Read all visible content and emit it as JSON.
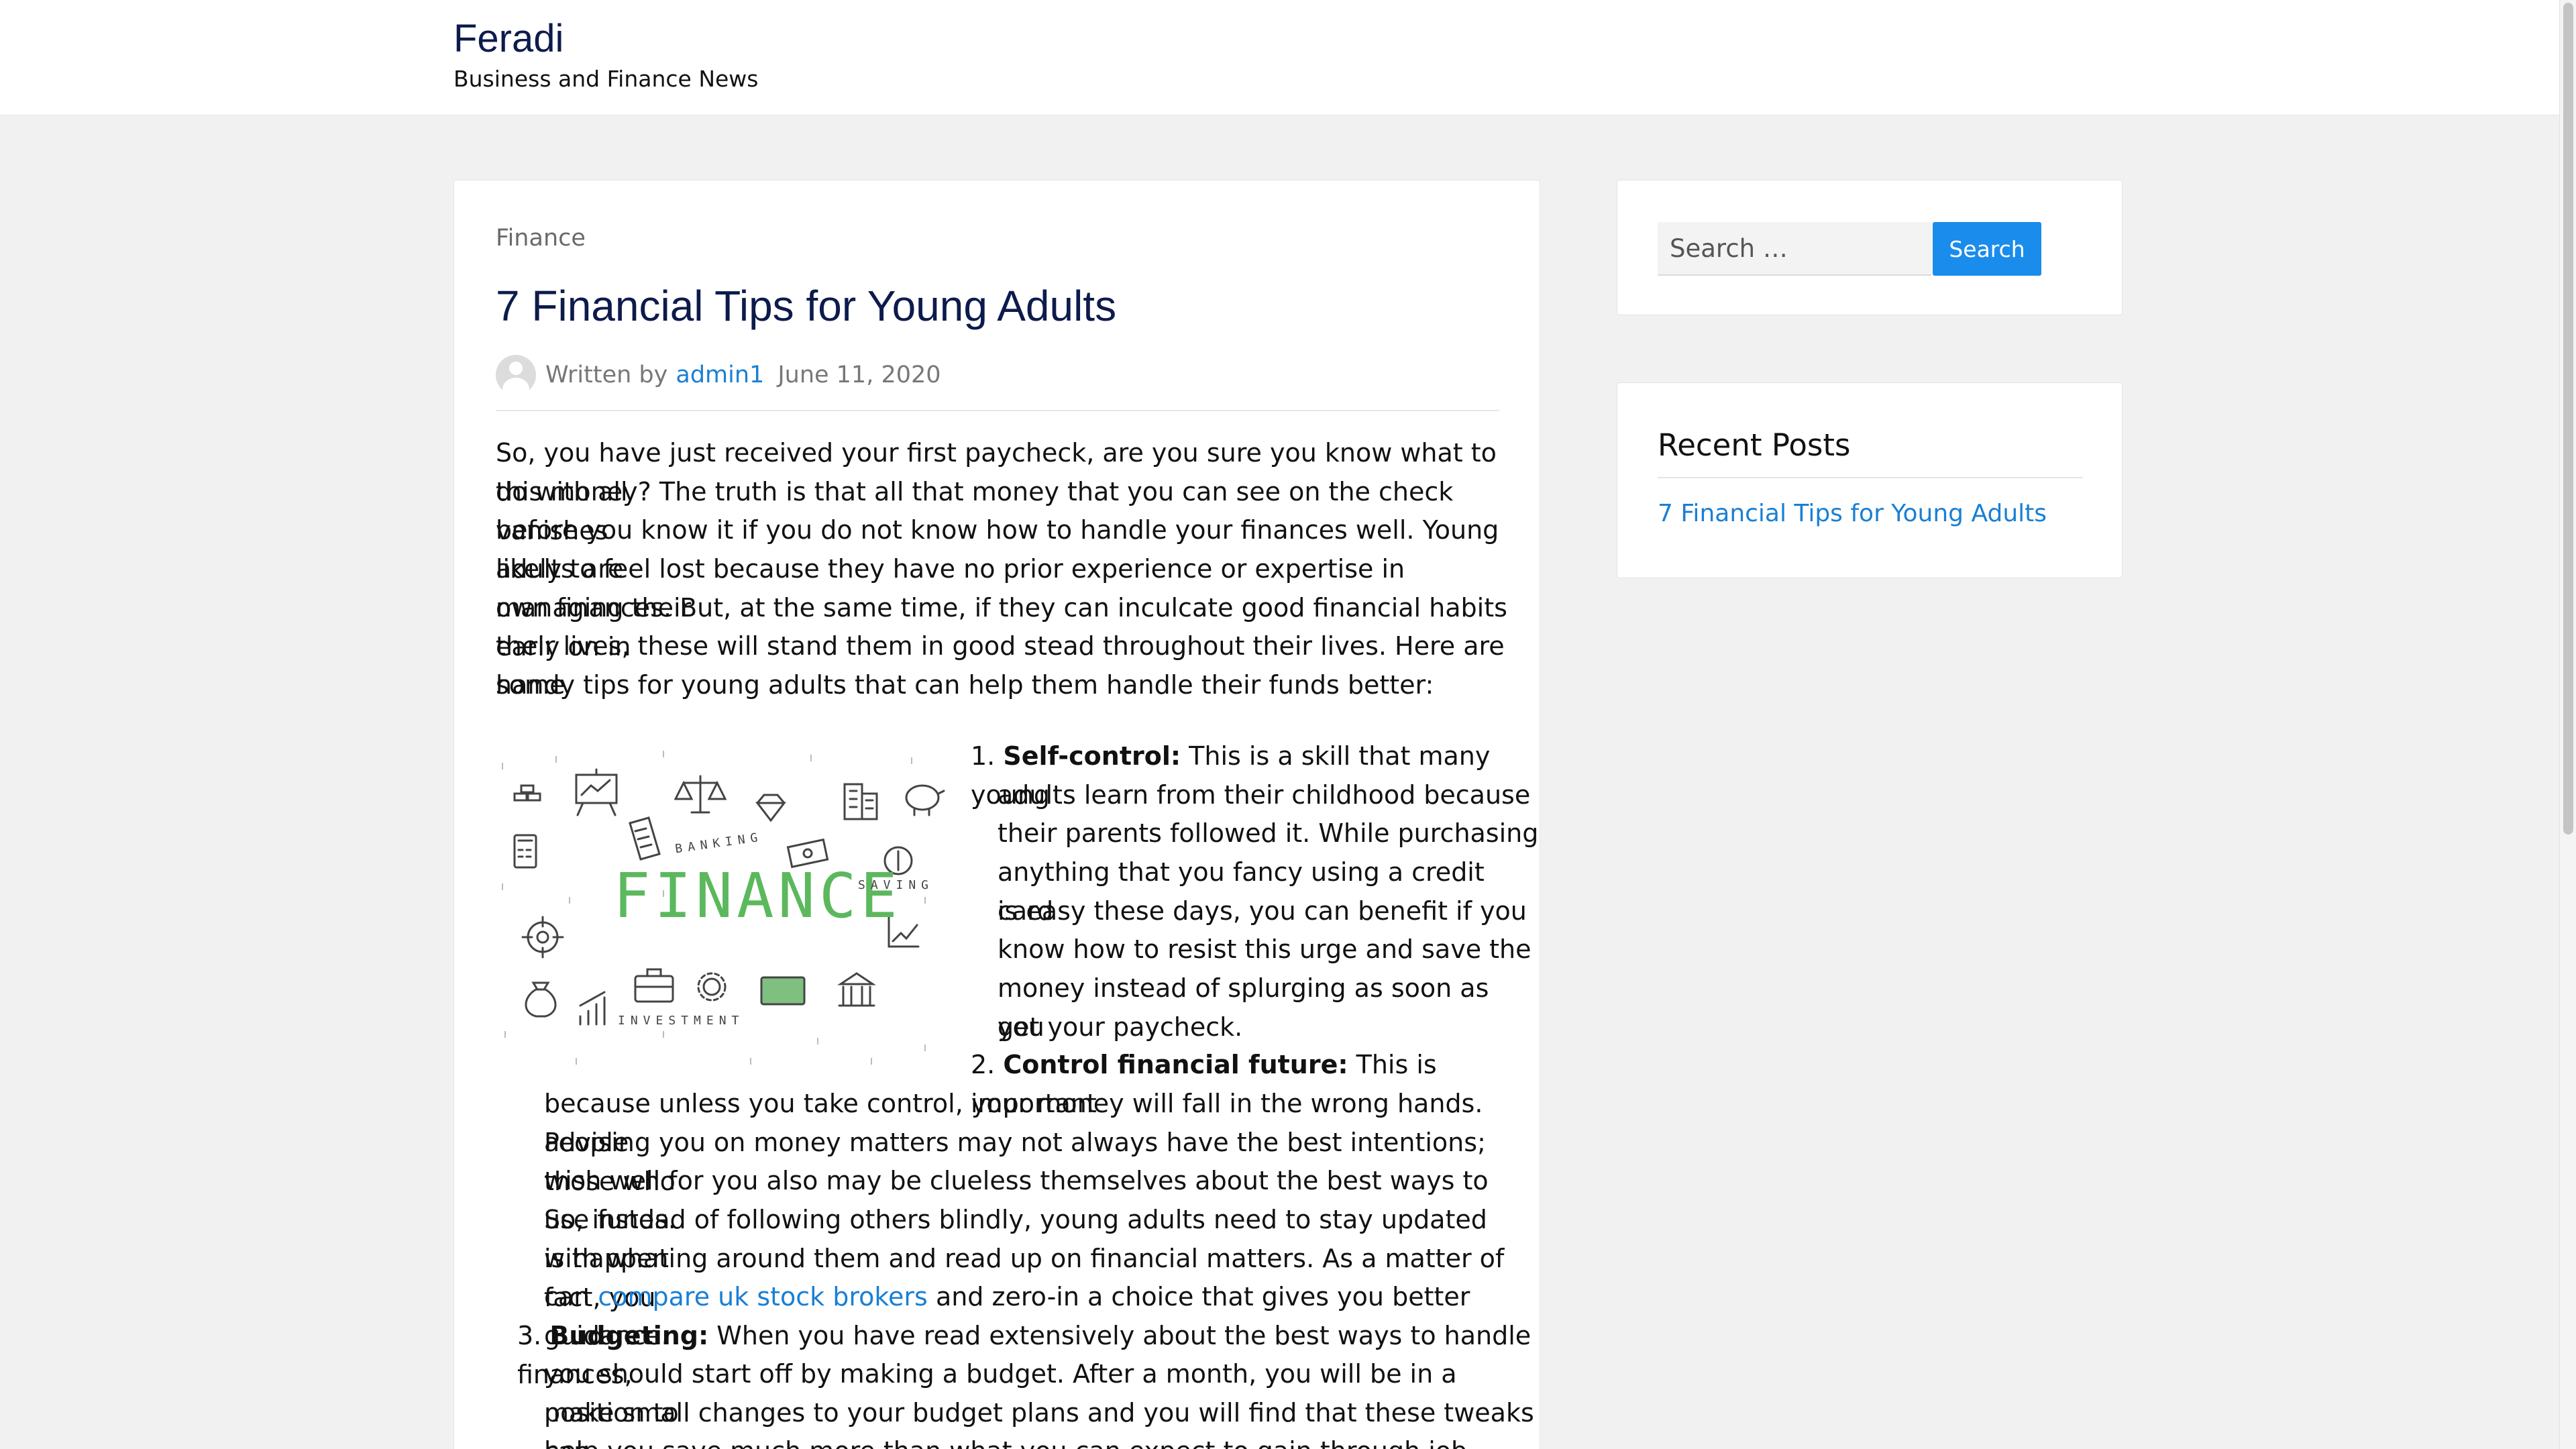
{
  "header": {
    "site_title": "Feradi",
    "site_description": "Business and Finance News"
  },
  "article": {
    "category": "Finance",
    "title": "7 Financial Tips for Young Adults",
    "meta": {
      "written_by": "Written by",
      "author": "admin1",
      "date": "June 11, 2020"
    },
    "intro_lines": [
      "So, you have just received your first paycheck, are you sure you know what to do with all",
      "this money? The truth is that all that money that you can see on the check vanishes",
      "before you know it if you do not know how to handle your finances well. Young adults are",
      "likely to feel lost because they have no prior experience or expertise in managing their",
      "own finances. But, at the same time, if they can inculcate good financial habits early on in",
      "their lives, these will stand them in good stead throughout their lives. Here are some",
      "handy tips for young adults that can help them handle their funds better:"
    ],
    "image_labels": {
      "main": "FINANCE",
      "banking": "BANKING",
      "saving": "SAVING",
      "investment": "INVESTMENT"
    },
    "tip1": {
      "number": "1.",
      "heading": "Self-control:",
      "first_line": " This is a skill that many young",
      "lines": [
        "adults learn from their childhood because",
        "their parents followed it. While purchasing",
        "anything that you fancy using a credit card",
        "is easy these days, you can benefit if you",
        "know how to resist this urge and save the",
        "money instead of splurging as soon as you",
        "get your paycheck."
      ]
    },
    "tip2": {
      "number": "2.",
      "heading": "Control financial future:",
      "first_line": " This is important",
      "lines": [
        "because unless you take control, your money will fall in the wrong hands. People",
        "advising you on money matters may not always have the best intentions; those who",
        "wish well for you also may be clueless themselves about the best ways to use funds.",
        "So, instead of following others blindly, young adults need to stay updated with what",
        "is happening around them and read up on financial matters. As a matter of fact, you"
      ],
      "last_line_prefix": "can ",
      "link_text": "compare uk stock brokers",
      "last_line_suffix": " and zero-in a choice that gives you better guidance."
    },
    "tip3": {
      "number": "3.",
      "heading": "Budgeting:",
      "first_line": " When you have read extensively about the best ways to handle finances,",
      "lines": [
        "you should start off by making a budget. After a month, you will be in a position to",
        "make small changes to your budget plans and you will find that these tweaks can",
        "help you save much more than what you can expect to gain through job promotions."
      ]
    }
  },
  "sidebar": {
    "search": {
      "placeholder": "Search …",
      "button_label": "Search"
    },
    "recent_posts": {
      "title": "Recent Posts",
      "items": [
        "7 Financial Tips for Young Adults"
      ]
    }
  },
  "colors": {
    "link": "#1a7fd4",
    "title": "#0d1b4c",
    "button": "#1a8cec",
    "finance_green": "#5cb85c"
  }
}
